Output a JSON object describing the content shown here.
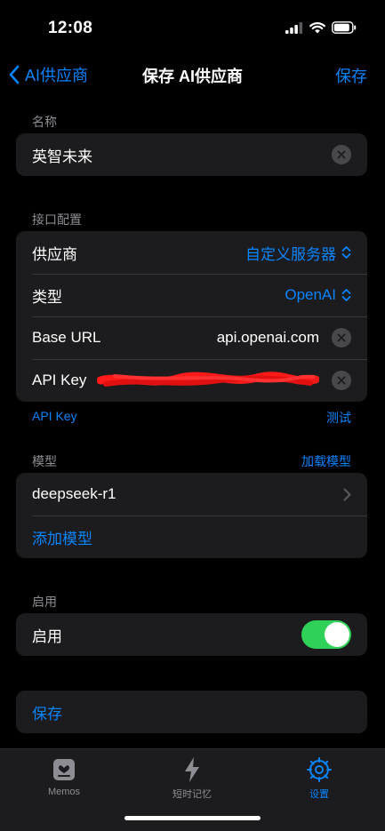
{
  "status_bar": {
    "time": "12:08"
  },
  "nav": {
    "back_label": "AI供应商",
    "title": "保存 AI供应商",
    "save_label": "保存"
  },
  "name_section": {
    "label": "名称",
    "value": "英智未来"
  },
  "api_section": {
    "label": "接口配置",
    "rows": [
      {
        "label": "供应商",
        "value": "自定义服务器"
      },
      {
        "label": "类型",
        "value": "OpenAI"
      },
      {
        "label": "Base URL",
        "value": "api.openai.com"
      },
      {
        "label": "API Key"
      }
    ],
    "footer_left": "API Key",
    "footer_right": "测试"
  },
  "model_section": {
    "label": "模型",
    "action": "加载模型",
    "model": "deepseek-r1",
    "add_label": "添加模型"
  },
  "enable_section": {
    "label": "启用",
    "row_label": "启用",
    "enabled": true
  },
  "save_section": {
    "label": "保存"
  },
  "tabs": [
    {
      "label": "Memos",
      "icon": "memo-icon"
    },
    {
      "label": "短时记忆",
      "icon": "bolt-icon"
    },
    {
      "label": "设置",
      "icon": "gear-icon",
      "active": true
    }
  ],
  "colors": {
    "accent": "#0a84ff",
    "toggle_on": "#30d158",
    "card": "#1c1c1e",
    "redaction": "#ff1a1a"
  }
}
